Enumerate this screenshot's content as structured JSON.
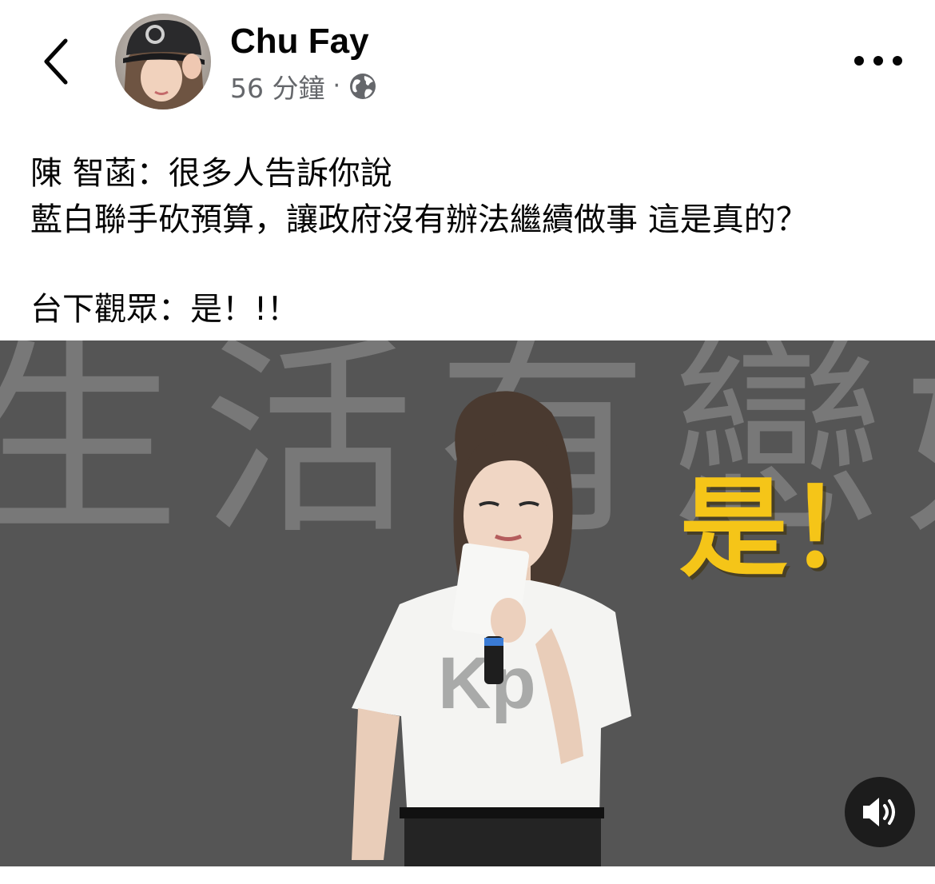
{
  "header": {
    "author_name": "Chu Fay",
    "timestamp": "56 分鐘",
    "separator": "·",
    "icons": {
      "back": "chevron-left-icon",
      "privacy": "globe-icon",
      "more": "more-horizontal-icon"
    }
  },
  "post": {
    "lines": [
      "陳 智菡：很多人告訴你說",
      "藍白聯手砍預算，讓政府沒有辦法繼續做事 這是真的？",
      "台下觀眾：是！!！"
    ]
  },
  "video": {
    "background_text": "生活有戀好",
    "caption": "是！",
    "shirt_logo": "Kp",
    "sound_icon": "speaker-volume-icon"
  },
  "colors": {
    "text_primary": "#050505",
    "text_secondary": "#65676b",
    "caption_yellow": "#f5c518"
  }
}
